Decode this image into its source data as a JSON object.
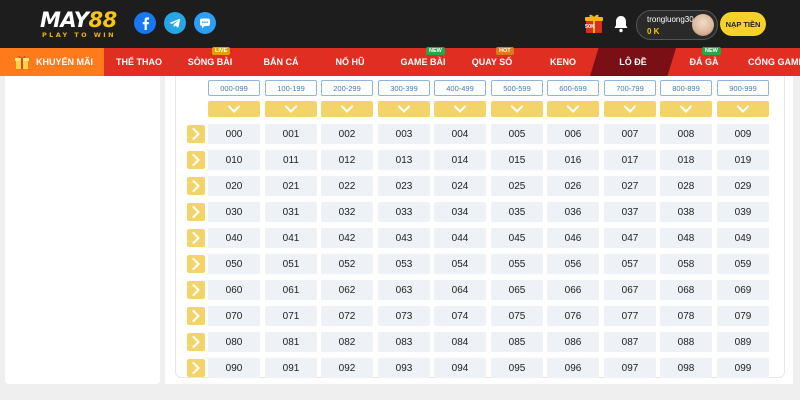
{
  "header": {
    "logo_main": "MAY",
    "logo_num": "88",
    "logo_tagline": "PLAY TO WIN",
    "username": "trongluong30...",
    "balance": "0 K",
    "deposit_label": "NẠP TIỀN",
    "gift_badge": "50K"
  },
  "nav": {
    "promo_label": "KHUYẾN MÃI",
    "items": [
      {
        "label": "THỂ THAO",
        "badge": ""
      },
      {
        "label": "SÒNG BÀI",
        "badge": "LIVE"
      },
      {
        "label": "BẮN CÁ",
        "badge": ""
      },
      {
        "label": "NỔ HŨ",
        "badge": ""
      },
      {
        "label": "GAME BÀI",
        "badge": "NEW"
      },
      {
        "label": "QUAY SỐ",
        "badge": "HOT"
      },
      {
        "label": "KENO",
        "badge": ""
      },
      {
        "label": "LÔ ĐỀ",
        "badge": "",
        "active": true
      },
      {
        "label": "ĐÁ GÀ",
        "badge": "NEW"
      },
      {
        "label": "CỔNG GAME",
        "badge": ""
      }
    ]
  },
  "ranges": [
    "000-099",
    "100-199",
    "200-299",
    "300-399",
    "400-499",
    "500-599",
    "600-699",
    "700-799",
    "800-899",
    "900-999"
  ],
  "grid": [
    [
      "000",
      "001",
      "002",
      "003",
      "004",
      "005",
      "006",
      "007",
      "008",
      "009"
    ],
    [
      "010",
      "011",
      "012",
      "013",
      "014",
      "015",
      "016",
      "017",
      "018",
      "019"
    ],
    [
      "020",
      "021",
      "022",
      "023",
      "024",
      "025",
      "026",
      "027",
      "028",
      "029"
    ],
    [
      "030",
      "031",
      "032",
      "033",
      "034",
      "035",
      "036",
      "037",
      "038",
      "039"
    ],
    [
      "040",
      "041",
      "042",
      "043",
      "044",
      "045",
      "046",
      "047",
      "048",
      "049"
    ],
    [
      "050",
      "051",
      "052",
      "053",
      "054",
      "055",
      "056",
      "057",
      "058",
      "059"
    ],
    [
      "060",
      "061",
      "062",
      "063",
      "064",
      "065",
      "066",
      "067",
      "068",
      "069"
    ],
    [
      "070",
      "071",
      "072",
      "073",
      "074",
      "075",
      "076",
      "077",
      "078",
      "079"
    ],
    [
      "080",
      "081",
      "082",
      "083",
      "084",
      "085",
      "086",
      "087",
      "088",
      "089"
    ],
    [
      "090",
      "091",
      "092",
      "093",
      "094",
      "095",
      "096",
      "097",
      "098",
      "099"
    ]
  ],
  "colors": {
    "header_bg": "#1d1d1d",
    "nav_bg": "#e02e22",
    "nav_active": "#7a0f15",
    "accent_yellow": "#f3d46a",
    "cell_bg": "#eef1f5"
  }
}
